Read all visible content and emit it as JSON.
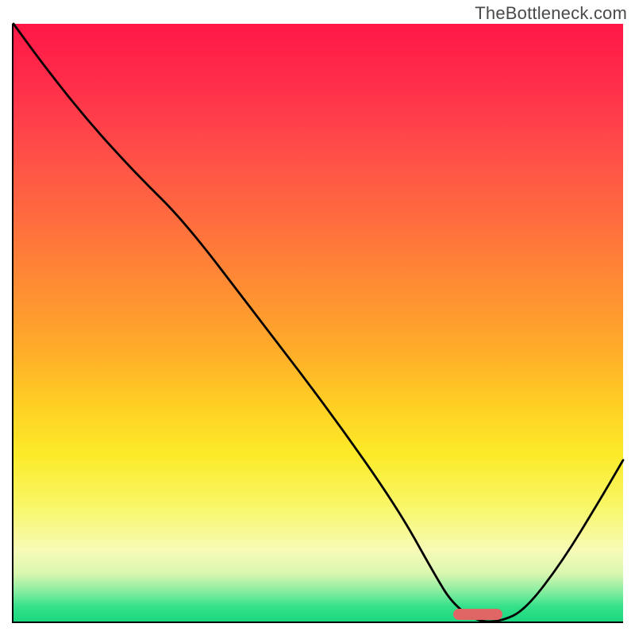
{
  "attribution": "TheBottleneck.com",
  "chart_data": {
    "type": "line",
    "title": "",
    "xlabel": "",
    "ylabel": "",
    "xlim": [
      0,
      100
    ],
    "ylim": [
      0,
      100
    ],
    "gradient_stops": [
      {
        "pct": 0,
        "color": "#ff1846"
      },
      {
        "pct": 9,
        "color": "#ff2b4a"
      },
      {
        "pct": 20,
        "color": "#ff4a49"
      },
      {
        "pct": 32,
        "color": "#ff6a3f"
      },
      {
        "pct": 43,
        "color": "#ff8a34"
      },
      {
        "pct": 54,
        "color": "#ffaa2a"
      },
      {
        "pct": 64,
        "color": "#ffd024"
      },
      {
        "pct": 72,
        "color": "#fcea28"
      },
      {
        "pct": 81,
        "color": "#f9f76a"
      },
      {
        "pct": 88,
        "color": "#f7fbb6"
      },
      {
        "pct": 92,
        "color": "#d9f7b0"
      },
      {
        "pct": 95,
        "color": "#86eda0"
      },
      {
        "pct": 97.5,
        "color": "#35e18a"
      },
      {
        "pct": 100,
        "color": "#19d77f"
      }
    ],
    "series": [
      {
        "name": "bottleneck-curve",
        "x": [
          0,
          5,
          12,
          20,
          28,
          40,
          52,
          63,
          69,
          72,
          76,
          80,
          84,
          90,
          96,
          100
        ],
        "y": [
          100,
          93,
          84,
          75,
          67,
          51,
          35,
          19,
          8,
          3,
          0,
          0,
          2,
          10,
          20,
          27
        ]
      }
    ],
    "optimum_marker": {
      "x_start": 72,
      "x_end": 80,
      "y": 1.2,
      "color": "#e06666"
    }
  }
}
